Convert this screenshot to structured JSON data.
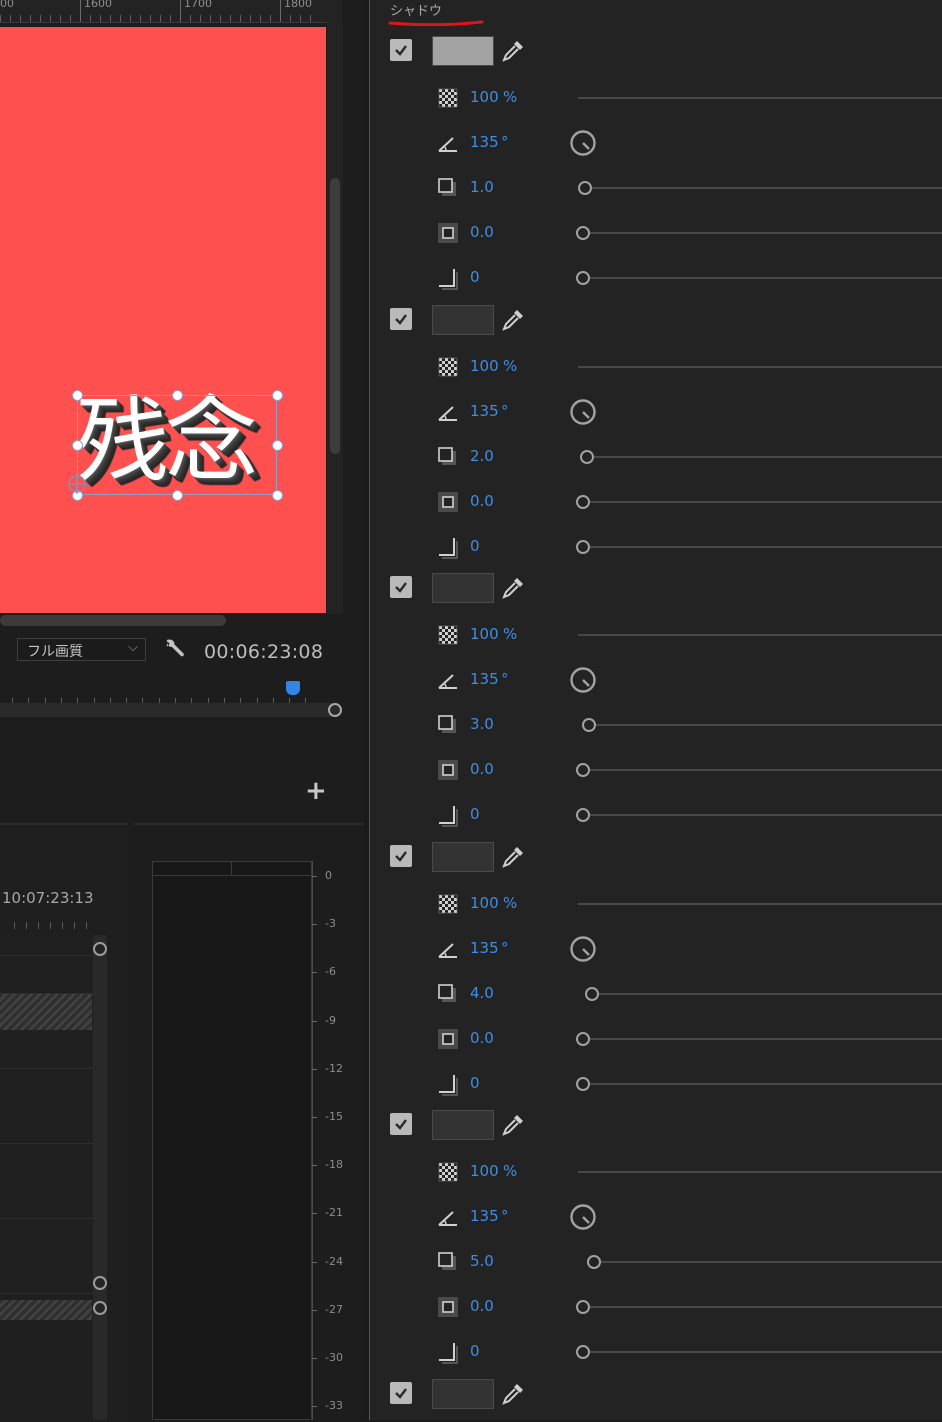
{
  "monitor": {
    "ruler_labels": [
      "00",
      "1600",
      "1700",
      "1800"
    ],
    "title_text": "残念",
    "quality_select": "フル画質",
    "timecode": "00:06:23:08",
    "add_button": "+"
  },
  "timeline": {
    "timecode": "10:07:23:13"
  },
  "audio_meter": {
    "db_labels": [
      "0",
      "-3",
      "-6",
      "-9",
      "-12",
      "-15",
      "-18",
      "-21",
      "-24",
      "-27",
      "-30",
      "-33"
    ]
  },
  "effect_controls": {
    "section_title": "シャドウ",
    "annotation_color": "#e0151b",
    "shadows": [
      {
        "enabled": true,
        "color": "#a3a3a3",
        "opacity": "100",
        "opacity_unit": "%",
        "angle": "135",
        "angle_unit": "°",
        "distance": "1.0",
        "size": "0.0",
        "blur": "0"
      },
      {
        "enabled": true,
        "color": "#333333",
        "opacity": "100",
        "opacity_unit": "%",
        "angle": "135",
        "angle_unit": "°",
        "distance": "2.0",
        "size": "0.0",
        "blur": "0"
      },
      {
        "enabled": true,
        "color": "#333333",
        "opacity": "100",
        "opacity_unit": "%",
        "angle": "135",
        "angle_unit": "°",
        "distance": "3.0",
        "size": "0.0",
        "blur": "0"
      },
      {
        "enabled": true,
        "color": "#333333",
        "opacity": "100",
        "opacity_unit": "%",
        "angle": "135",
        "angle_unit": "°",
        "distance": "4.0",
        "size": "0.0",
        "blur": "0"
      },
      {
        "enabled": true,
        "color": "#333333",
        "opacity": "100",
        "opacity_unit": "%",
        "angle": "135",
        "angle_unit": "°",
        "distance": "5.0",
        "size": "0.0",
        "blur": "0"
      },
      {
        "enabled": true,
        "color": "#333333"
      }
    ]
  },
  "colors": {
    "canvas_red": "#fe514f",
    "value_blue": "#3d8ee6",
    "playhead_blue": "#2f86e6"
  }
}
